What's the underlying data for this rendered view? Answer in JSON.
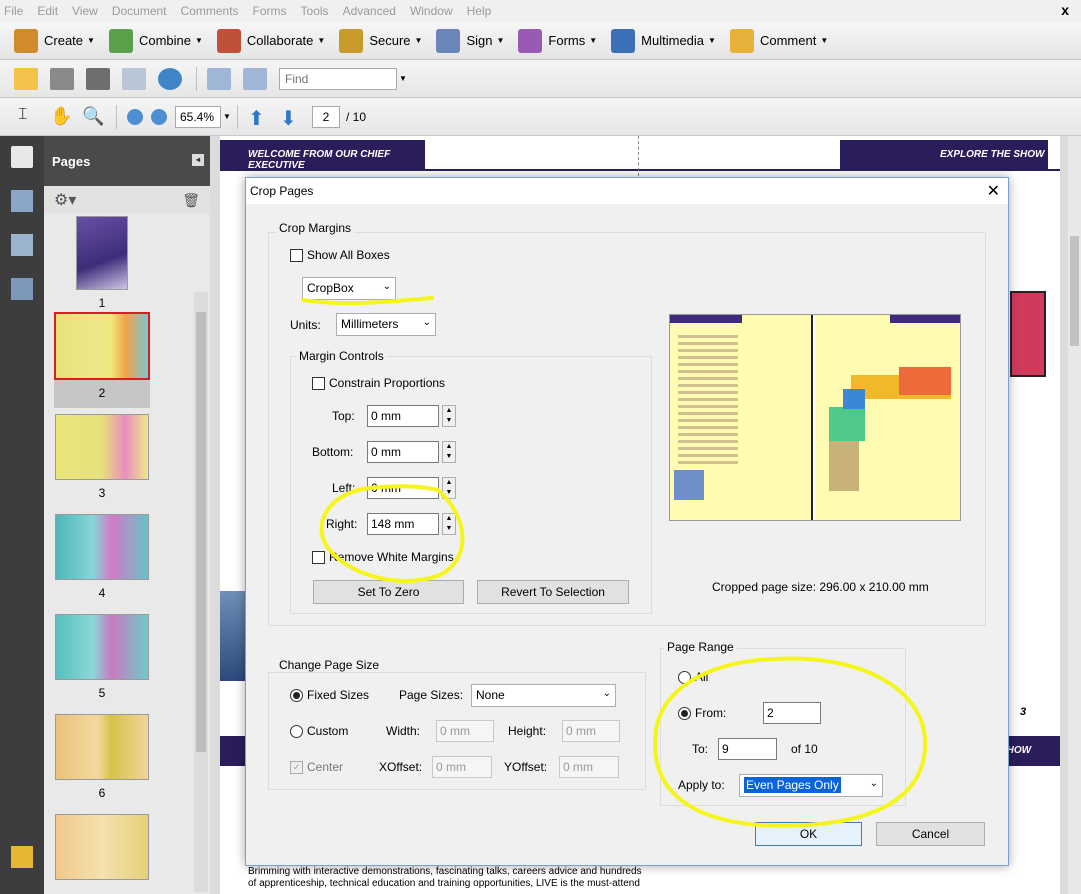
{
  "menubar": {
    "items": [
      "File",
      "Edit",
      "View",
      "Document",
      "Comments",
      "Forms",
      "Tools",
      "Advanced",
      "Window",
      "Help"
    ],
    "close": "x"
  },
  "tasks": [
    {
      "label": "Create",
      "icon": "create-icon",
      "color": "#d08b2c"
    },
    {
      "label": "Combine",
      "icon": "combine-icon",
      "color": "#5aa04a"
    },
    {
      "label": "Collaborate",
      "icon": "collaborate-icon",
      "color": "#c0503a"
    },
    {
      "label": "Secure",
      "icon": "lock-icon",
      "color": "#c79a2a"
    },
    {
      "label": "Sign",
      "icon": "pen-icon",
      "color": "#6a86b8"
    },
    {
      "label": "Forms",
      "icon": "forms-icon",
      "color": "#9b59b6"
    },
    {
      "label": "Multimedia",
      "icon": "multimedia-icon",
      "color": "#3b6fb6"
    },
    {
      "label": "Comment",
      "icon": "comment-icon",
      "color": "#e8b23a"
    }
  ],
  "filebar": {
    "find_placeholder": "Find"
  },
  "navbar": {
    "zoom": "65.4%",
    "page": "2",
    "page_total": "/ 10"
  },
  "pages_panel": {
    "title": "Pages",
    "thumbnails": [
      "1",
      "2",
      "3",
      "4",
      "5",
      "6"
    ]
  },
  "document": {
    "banner_left": "WELCOME FROM OUR CHIEF EXECUTIVE",
    "banner_right": "EXPLORE THE SHOW",
    "banner_right_2": "SHOW",
    "page_number": "3",
    "footer_text_1": "Brimming with interactive demonstrations, fascinating talks, careers advice and hundreds",
    "footer_text_2": "of apprenticeship, technical education and training opportunities, LIVE is the must-attend"
  },
  "dialog": {
    "title": "Crop Pages",
    "close": "✕",
    "crop_margins": {
      "label": "Crop Margins",
      "show_all_boxes": "Show All Boxes",
      "box_select": "CropBox",
      "units_label": "Units:",
      "units_value": "Millimeters"
    },
    "margin_controls": {
      "label": "Margin Controls",
      "constrain": "Constrain Proportions",
      "top_label": "Top:",
      "top_value": "0 mm",
      "bottom_label": "Bottom:",
      "bottom_value": "0 mm",
      "left_label": "Left:",
      "left_value": "0 mm",
      "right_label": "Right:",
      "right_value": "148 mm",
      "remove_white": "Remove White Margins",
      "set_zero": "Set To Zero",
      "revert": "Revert To Selection"
    },
    "cropped_size": "Cropped page size: 296.00 x 210.00 mm",
    "change_page_size": {
      "label": "Change Page Size",
      "fixed": "Fixed Sizes",
      "page_sizes_label": "Page Sizes:",
      "page_sizes_value": "None",
      "custom": "Custom",
      "width_label": "Width:",
      "width_value": "0 mm",
      "height_label": "Height:",
      "height_value": "0 mm",
      "center": "Center",
      "xoffset_label": "XOffset:",
      "xoffset_value": "0 mm",
      "yoffset_label": "YOffset:",
      "yoffset_value": "0 mm"
    },
    "page_range": {
      "label": "Page Range",
      "all": "All",
      "from_label": "From:",
      "from_value": "2",
      "to_label": "To:",
      "to_value": "9",
      "of_total": "of 10",
      "apply_label": "Apply to:",
      "apply_value": "Even Pages Only"
    },
    "ok": "OK",
    "cancel": "Cancel"
  },
  "colors": {
    "annotation_yellow": "#f5f51a",
    "banner_purple": "#2b1d5a",
    "selected_border": "#d42020"
  }
}
